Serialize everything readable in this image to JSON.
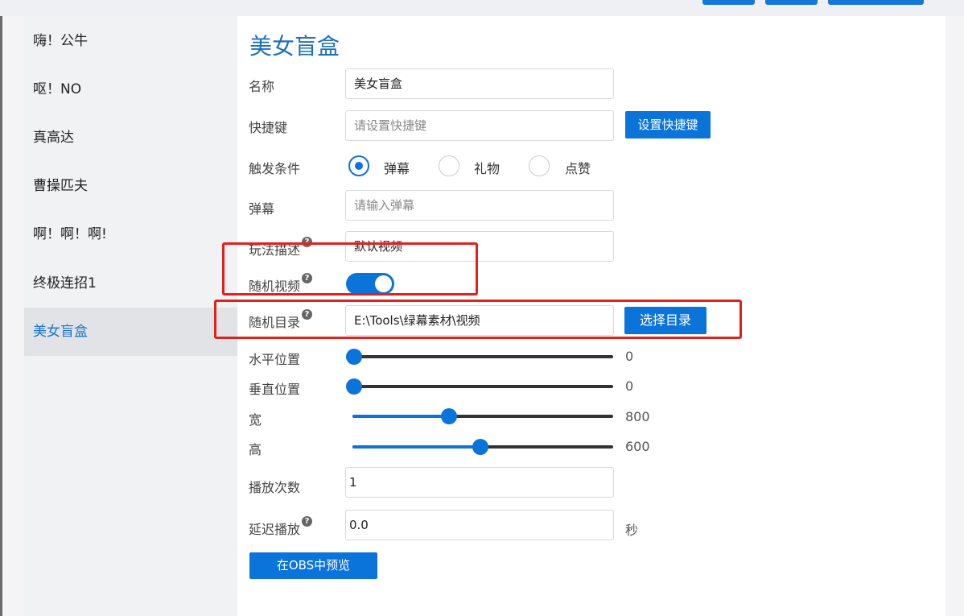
{
  "sidebar": {
    "items": [
      {
        "label": "嗨！公牛"
      },
      {
        "label": "呕！NO"
      },
      {
        "label": "真高达"
      },
      {
        "label": "曹操匹夫"
      },
      {
        "label": "啊！啊！啊!"
      },
      {
        "label": "终极连招1"
      },
      {
        "label": "美女盲盒",
        "active": true
      }
    ]
  },
  "form": {
    "title": "美女盲盒",
    "name": {
      "label": "名称",
      "value": "美女盲盒"
    },
    "hotkey": {
      "label": "快捷键",
      "placeholder": "请设置快捷键",
      "button": "设置快捷键"
    },
    "trigger": {
      "label": "触发条件",
      "options": [
        {
          "label": "弹幕",
          "checked": true
        },
        {
          "label": "礼物",
          "checked": false
        },
        {
          "label": "点赞",
          "checked": false
        }
      ]
    },
    "danmu": {
      "label": "弹幕",
      "placeholder": "请输入弹幕"
    },
    "description": {
      "label": "玩法描述",
      "value": "默认视频"
    },
    "random_video": {
      "label": "随机视频",
      "enabled": true
    },
    "random_dir": {
      "label": "随机目录",
      "value": "E:\\Tools\\绿幕素材\\视频",
      "button": "选择目录"
    },
    "sliders": [
      {
        "label": "水平位置",
        "value": "0",
        "fraction": 0.0
      },
      {
        "label": "垂直位置",
        "value": "0",
        "fraction": 0.0
      },
      {
        "label": "宽",
        "value": "800",
        "fraction": 0.37
      },
      {
        "label": "高",
        "value": "600",
        "fraction": 0.49
      }
    ],
    "play_count": {
      "label": "播放次数",
      "value": "1"
    },
    "delay": {
      "label": "延迟播放",
      "value": "0.0",
      "unit": "秒"
    },
    "preview_button": "在OBS中预览"
  },
  "colors": {
    "accent": "#0a74da",
    "highlight_box": "#e0221e"
  },
  "icons": {
    "help": "question-circle-icon"
  }
}
